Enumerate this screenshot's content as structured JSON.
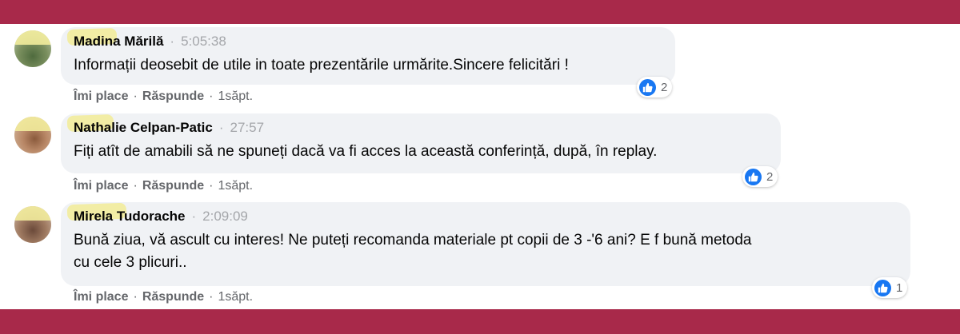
{
  "comments": [
    {
      "author": "Madina Mărilă",
      "time": "5:05:38",
      "text": "Informații deosebit de utile in toate prezentările urmărite.Sincere felicitări !",
      "reactions": "2",
      "like": "Îmi place",
      "reply": "Răspunde",
      "age": "1săpt."
    },
    {
      "author": "Nathalie Celpan-Patic",
      "time": "27:57",
      "text": "Fiți atît de amabili să ne spuneți dacă va fi acces la această conferință, după, în replay.",
      "reactions": "2",
      "like": "Îmi place",
      "reply": "Răspunde",
      "age": "1săpt."
    },
    {
      "author": "Mirela Tudorache",
      "time": "2:09:09",
      "text_line1": "Bună ziua, vă ascult cu interes! Ne puteți recomanda materiale pt copii de 3 -'6 ani? E f bună metoda",
      "text_line2": "cu cele 3 plicuri..",
      "reactions": "1",
      "like": "Îmi place",
      "reply": "Răspunde",
      "age": "1săpt."
    }
  ],
  "colors": {
    "frame": "#a8294a",
    "bubble": "#f0f2f5",
    "like_blue": "#1877f2",
    "secondary_text": "#65676b"
  },
  "icons": [
    "like-icon",
    "avatar"
  ]
}
